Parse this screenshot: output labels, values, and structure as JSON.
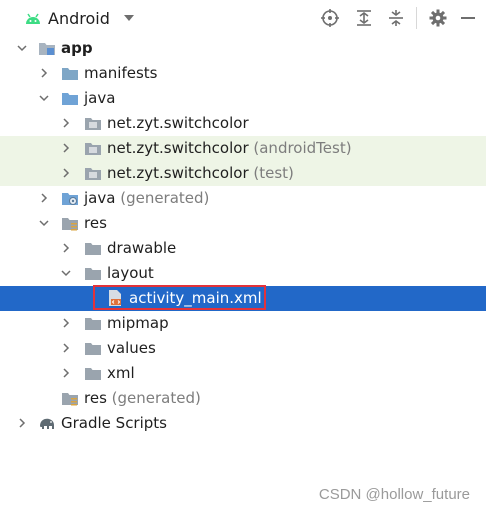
{
  "toolbar": {
    "view_label": "Android",
    "icons": [
      "locate-icon",
      "expand-all-icon",
      "collapse-all-icon",
      "settings-gear-icon",
      "hide-minus-icon"
    ]
  },
  "tree": {
    "app": "app",
    "manifests": "manifests",
    "java": "java",
    "pkg_main": "net.zyt.switchcolor",
    "pkg_android_test": "net.zyt.switchcolor",
    "pkg_android_test_suffix": "(androidTest)",
    "pkg_test": "net.zyt.switchcolor",
    "pkg_test_suffix": "(test)",
    "java_generated": "java",
    "java_generated_suffix": "(generated)",
    "res": "res",
    "drawable": "drawable",
    "layout": "layout",
    "activity_main": "activity_main.xml",
    "mipmap": "mipmap",
    "values": "values",
    "xml": "xml",
    "res_generated": "res",
    "res_generated_suffix": "(generated)",
    "gradle_scripts": "Gradle Scripts"
  },
  "colors": {
    "selection": "#2268c8",
    "test_row": "#eef5e6",
    "highlight": "#e3323a",
    "folder": "#7ea6c6",
    "android_green": "#3ddc84"
  },
  "watermark": "CSDN @hollow_future"
}
